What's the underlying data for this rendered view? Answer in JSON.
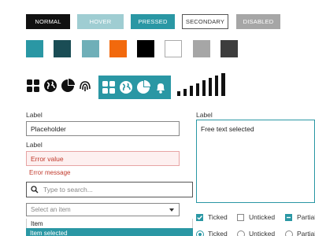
{
  "buttons": {
    "normal": "NORMAL",
    "hover": "HOVER",
    "pressed": "PRESSED",
    "secondary": "SECONDARY",
    "disabled": "DISABLED"
  },
  "colors": {
    "swatches": [
      "#2a97a4",
      "#1a4d55",
      "#6fafb8",
      "#f2690d",
      "#000000",
      "#ffffff",
      "#a6a6a6",
      "#3d3d3d"
    ],
    "accent": "#2a97a4",
    "error": "#c0392b"
  },
  "icons": {
    "set": [
      "grid-icon",
      "globe-icon",
      "pie-chart-icon",
      "fingerprint-icon",
      "bell-icon"
    ],
    "signal": "signal-bars-icon"
  },
  "form": {
    "text_label": "Label",
    "text_placeholder": "Placeholder",
    "error_label": "Label",
    "error_value": "Error value",
    "error_message": "Error message",
    "search_placeholder": "Type to search...",
    "select_placeholder": "Select an item",
    "options": [
      "Item",
      "Item selected"
    ],
    "textarea_label": "Label",
    "textarea_value": "Free text selected"
  },
  "checkboxes": {
    "ticked": "Ticked",
    "unticked": "Unticked",
    "partial": "Partial"
  },
  "radios": {
    "ticked": "Ticked",
    "unticked": "Unticked",
    "partial": "Partial"
  }
}
